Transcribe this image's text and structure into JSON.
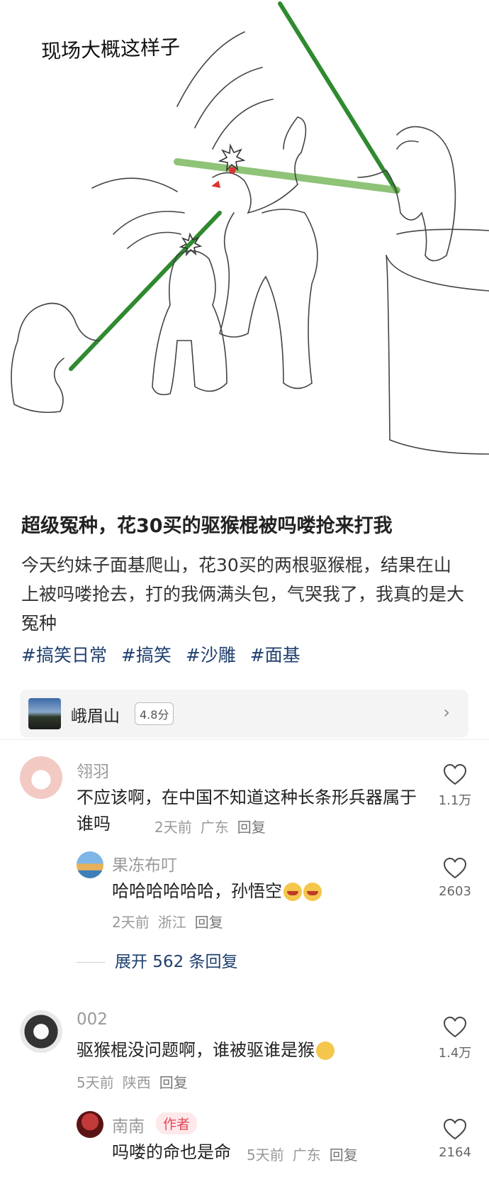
{
  "illustration": {
    "caption": "现场大概这样子"
  },
  "post": {
    "title": "超级冤种，花30买的驱猴棍被吗喽抢来打我",
    "body": "今天约妹子面基爬山，花30买的两根驱猴棍，结果在山上被吗喽抢去，打的我俩满头包，气哭我了，我真的是大冤种",
    "tags": [
      "#搞笑日常",
      "#搞笑",
      "#沙雕",
      "#面基"
    ]
  },
  "location": {
    "name": "峨眉山",
    "score": "4.8分"
  },
  "comments": [
    {
      "name": "翎羽",
      "text": "不应该啊，在中国不知道这种长条形兵器属于谁吗",
      "time": "2天前",
      "region": "广东",
      "reply": "回复",
      "likes": "1.1万"
    },
    {
      "name": "果冻布叮",
      "text": "哈哈哈哈哈哈，孙悟空",
      "time": "2天前",
      "region": "浙江",
      "reply": "回复",
      "likes": "2603"
    },
    {
      "name": "002",
      "text": "驱猴棍没问题啊，谁被驱谁是猴",
      "time": "5天前",
      "region": "陕西",
      "reply": "回复",
      "likes": "1.4万"
    },
    {
      "name": "南南",
      "badge": "作者",
      "text": "吗喽的命也是命",
      "time": "5天前",
      "region": "广东",
      "reply": "回复",
      "likes": "2164"
    }
  ],
  "expand_replies": "展开 562 条回复",
  "colors": {
    "accent": "#1f3f6e",
    "bamboo": "#2f8a2f",
    "badge": "#e24a5a"
  },
  "icons": [
    "heart-icon",
    "chevron-right-icon"
  ]
}
